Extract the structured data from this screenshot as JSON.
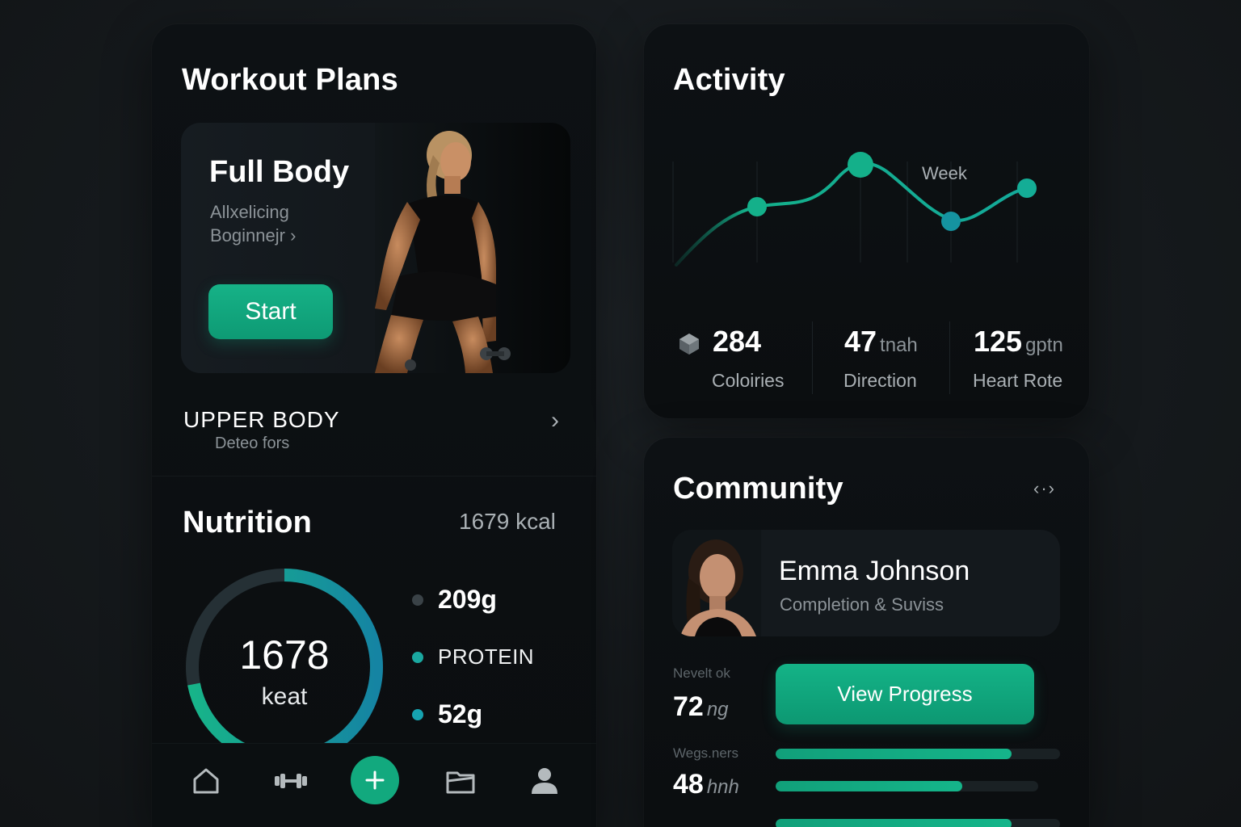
{
  "workout": {
    "title": "Workout Plans",
    "hero": {
      "title": "Full Body",
      "subtitle_line1": "Allxelicing",
      "subtitle_line2": "Boginnejr ›",
      "start_label": "Start"
    },
    "upper_body": {
      "title": "UPPER BODY",
      "subtitle": "Deteo fors",
      "chevron": "›"
    }
  },
  "nutrition": {
    "title": "Nutrition",
    "total_kcal": "1679 kcal",
    "ring_value": "1678",
    "ring_unit": "keat",
    "ring_fill_fraction": 0.72,
    "macros": [
      {
        "label": "209g",
        "dot_color": "#3a4247"
      },
      {
        "label": "PROTEIN",
        "dot_color": "#1aa8a0"
      },
      {
        "label": "52g",
        "dot_color": "#16a3b0"
      }
    ]
  },
  "nav": {
    "items": [
      {
        "icon": "home-icon"
      },
      {
        "icon": "dumbbell-icon"
      },
      {
        "icon": "plus-icon"
      },
      {
        "icon": "folder-icon"
      },
      {
        "icon": "profile-icon"
      }
    ]
  },
  "activity": {
    "title": "Activity",
    "chart_label": "Week",
    "stats": [
      {
        "value": "284",
        "unit": "",
        "label": "Coloiries",
        "icon": "cube-icon"
      },
      {
        "value": "47",
        "unit": "tnah",
        "label": "Direction"
      },
      {
        "value": "125",
        "unit": "gptn",
        "label": "Heart Rote"
      }
    ]
  },
  "community": {
    "title": "Community",
    "arrows": "‹·›",
    "profile": {
      "name": "Emma Johnson",
      "subtitle": "Completion & Suviss"
    },
    "metrics": [
      {
        "label": "Nevelt ok",
        "value": "72",
        "unit": "ng"
      },
      {
        "label": "Wegs.ners",
        "value": "48",
        "unit": "hnh"
      }
    ],
    "view_progress_label": "View Progress",
    "progress": [
      0.83,
      0.71,
      0.83
    ]
  },
  "colors": {
    "accent": "#12a97e",
    "line": "#14b08a",
    "card": "#0c1013",
    "background": "#171b1e"
  }
}
